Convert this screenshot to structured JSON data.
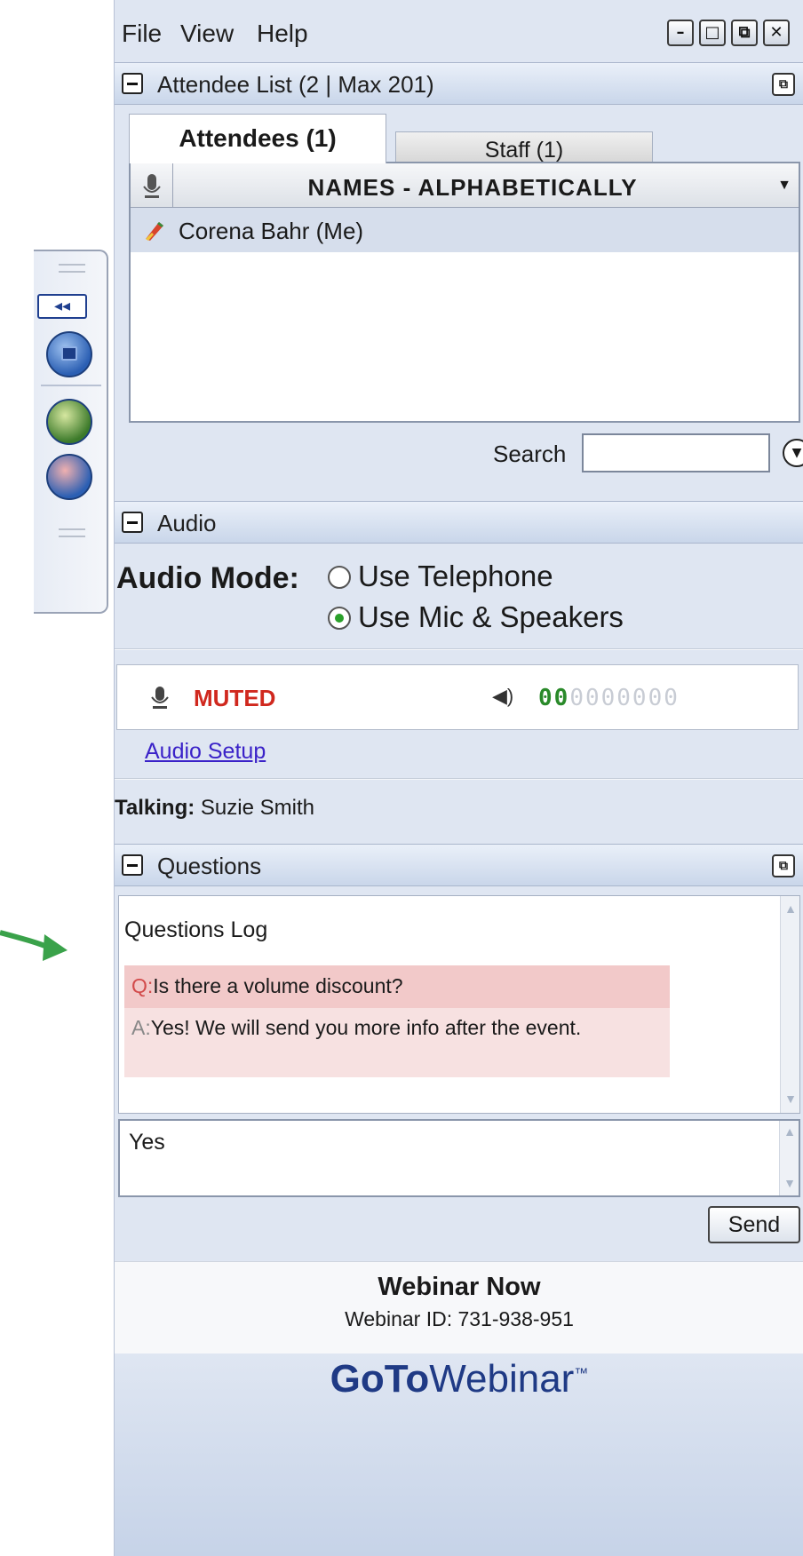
{
  "menu": {
    "file": "File",
    "view": "View",
    "help": "Help"
  },
  "window_controls": {
    "minimize": "–",
    "maximize": "□",
    "restore": "⧉",
    "close": "✕"
  },
  "attendee_panel": {
    "title": "Attendee List   (2 | Max 201)",
    "tabs": [
      {
        "label": "Attendees (1)",
        "active": true
      },
      {
        "label": "Staff (1)",
        "active": false
      }
    ],
    "column_header": "NAMES - ALPHABETICALLY",
    "rows": [
      {
        "name": "Corena Bahr (Me)"
      }
    ],
    "search_label": "Search",
    "search_value": ""
  },
  "audio_panel": {
    "title": "Audio",
    "mode_label": "Audio Mode:",
    "options": [
      {
        "label": "Use Telephone",
        "selected": false
      },
      {
        "label": "Use Mic & Speakers",
        "selected": true
      }
    ],
    "status": "MUTED",
    "status_color": "#d0281e",
    "level_active": "00",
    "level_inactive": "0000000",
    "setup_link": "Audio Setup",
    "talking_label": "Talking:",
    "talking_name": "Suzie Smith"
  },
  "questions_panel": {
    "title": "Questions",
    "log_title": "Questions Log",
    "q_prefix": "Q:",
    "question": "Is there a volume discount?",
    "a_prefix": "A:",
    "answer": "Yes! We will send you more info after the event.",
    "input_value": "Yes",
    "send_label": "Send"
  },
  "footer": {
    "title": "Webinar Now",
    "webinar_id": "Webinar ID: 731-938-951"
  },
  "brand": {
    "goto": "GoTo",
    "webinar": "Webinar",
    "tm": "™"
  },
  "colors": {
    "accent": "#1f3a85",
    "arrow": "#3aa24a",
    "muted": "#d0281e"
  },
  "icons": [
    "collapse-icon",
    "screen-icon",
    "hand-raise-icon",
    "no-audio-icon",
    "mic-icon",
    "speaker-icon",
    "pencil-icon",
    "dropdown-icon",
    "popout-icon",
    "minimize-icon"
  ]
}
